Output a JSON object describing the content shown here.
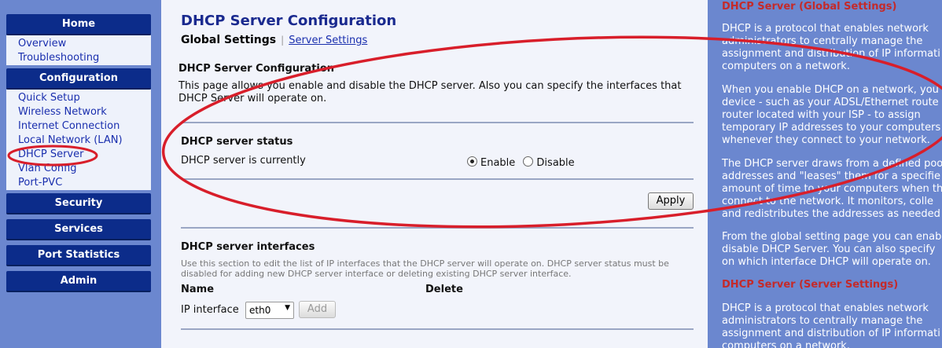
{
  "nav": {
    "home": "Home",
    "home_items": [
      "Overview",
      "Troubleshooting"
    ],
    "configuration": "Configuration",
    "config_items": [
      "Quick Setup",
      "Wireless Network",
      "Internet Connection",
      "Local Network (LAN)",
      "DHCP Server",
      "Vlan Config",
      "Port-PVC"
    ],
    "security": "Security",
    "services": "Services",
    "port_statistics": "Port Statistics",
    "admin": "Admin"
  },
  "main": {
    "title": "DHCP Server Configuration",
    "tab_current": "Global Settings",
    "tab_separator": "|",
    "tab_link": "Server Settings",
    "section_heading": "DHCP Server Configuration",
    "section_desc_1": "This page allows you enable and disable the DHCP server. Also you can specify the interfaces that",
    "section_desc_2": "DHCP Server will operate on.",
    "status_heading": "DHCP server status",
    "status_label": "DHCP server is currently",
    "enable_label": "Enable",
    "disable_label": "Disable",
    "status_selected": "Enable",
    "apply_label": "Apply",
    "interfaces_heading": "DHCP server interfaces",
    "interfaces_note_1": "Use this section to edit the list of IP interfaces that the DHCP server will operate on. DHCP server status must be",
    "interfaces_note_2": "disabled for adding new DHCP server interface or deleting existing DHCP server interface.",
    "col_name": "Name",
    "col_delete": "Delete",
    "ip_interface_label": "IP interface",
    "ip_interface_value": "eth0",
    "add_label": "Add"
  },
  "help": {
    "title_global": "DHCP Server (Global Settings)",
    "p1": [
      "DHCP is a protocol that enables network",
      "administrators to centrally manage the",
      "assignment and distribution of IP informati",
      "computers on a network."
    ],
    "p2": [
      "When you enable DHCP on a network, you",
      "device - such as your ADSL/Ethernet route",
      "router located with your ISP - to assign",
      "temporary IP addresses to your computers",
      "whenever they connect to your network."
    ],
    "p3": [
      "The DHCP server draws from a defined poo",
      "addresses and \"leases\" them for a specifie",
      "amount of time to your computers when th",
      "connect to the network. It monitors, colle",
      "and redistributes the addresses as needed"
    ],
    "p4": [
      "From the global setting page you can enab",
      "disable DHCP Server. You can also specify",
      "on which interface DHCP will operate on."
    ],
    "title_server": "DHCP Server (Server Settings)",
    "p5": [
      "DHCP is a protocol that enables network",
      "administrators to centrally manage the",
      "assignment and distribution of IP informati",
      "computers on a network."
    ]
  },
  "colors": {
    "nav_button": "#0c2c8a",
    "background": "#6b87cf",
    "annotation": "#d81e2a",
    "help_title": "#c42a2a"
  }
}
